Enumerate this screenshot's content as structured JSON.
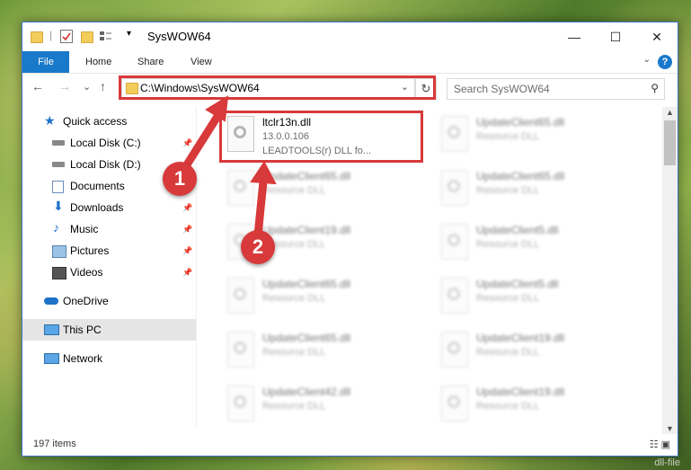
{
  "window": {
    "title": "SysWOW64",
    "qat_separator": "|",
    "qat_dropdown": "▾",
    "controls": {
      "minimize": "—",
      "maximize": "☐",
      "close": "✕"
    }
  },
  "ribbon": {
    "file": "File",
    "tabs": [
      "Home",
      "Share",
      "View"
    ],
    "collapse": "⌄",
    "help": "?"
  },
  "nav": {
    "back": "←",
    "forward": "→",
    "recent": "⌄",
    "up": "↑",
    "address": "C:\\Windows\\SysWOW64",
    "address_dropdown": "⌄",
    "refresh": "↻",
    "search_placeholder": "Search SysWOW64",
    "search_icon": "⚲"
  },
  "sidebar": {
    "pin_glyph": "📌",
    "items": [
      {
        "label": "Quick access",
        "icon": "star-icon",
        "pinned": false
      },
      {
        "label": "Local Disk (C:)",
        "icon": "drive-icon",
        "pinned": true
      },
      {
        "label": "Local Disk (D:)",
        "icon": "drive-icon",
        "pinned": false
      },
      {
        "label": "Documents",
        "icon": "documents-icon",
        "pinned": true
      },
      {
        "label": "Downloads",
        "icon": "download-icon",
        "pinned": true
      },
      {
        "label": "Music",
        "icon": "music-icon",
        "pinned": true
      },
      {
        "label": "Pictures",
        "icon": "pictures-icon",
        "pinned": true
      },
      {
        "label": "Videos",
        "icon": "videos-icon",
        "pinned": true
      },
      {
        "label": "OneDrive",
        "icon": "cloud-icon",
        "pinned": false
      },
      {
        "label": "This PC",
        "icon": "pc-icon",
        "pinned": false,
        "selected": true
      },
      {
        "label": "Network",
        "icon": "network-icon",
        "pinned": false
      }
    ]
  },
  "files": {
    "highlighted": {
      "name": "ltclr13n.dll",
      "version": "13.0.0.106",
      "desc": "LEADTOOLS(r) DLL fo..."
    },
    "left_col": [
      {
        "name": "UpdateClient65.dll",
        "type": "Resource DLL"
      },
      {
        "name": "UpdateClient19.dll",
        "type": "Resource DLL"
      },
      {
        "name": "UpdateClient65.dll",
        "type": "Resource DLL"
      },
      {
        "name": "UpdateClient65.dll",
        "type": "Resource DLL"
      },
      {
        "name": "UpdateClient42.dll",
        "type": "Resource DLL"
      }
    ],
    "right_col": [
      {
        "name": "UpdateClient65.dll",
        "type": "Resource DLL"
      },
      {
        "name": "UpdateClient65.dll",
        "type": "Resource DLL"
      },
      {
        "name": "UpdateClient5.dll",
        "type": "Resource DLL"
      },
      {
        "name": "UpdateClient5.dll",
        "type": "Resource DLL"
      },
      {
        "name": "UpdateClient19.dll",
        "type": "Resource DLL"
      },
      {
        "name": "UpdateClient19.dll",
        "type": "Resource DLL"
      }
    ]
  },
  "scrollbar": {
    "up": "▲",
    "down": "▼"
  },
  "status": {
    "count": "197 items",
    "view_icons": "☷ ▣"
  },
  "annotations": {
    "badge1": "1",
    "badge2": "2",
    "color": "#d8393a"
  },
  "watermark": "dll-file"
}
